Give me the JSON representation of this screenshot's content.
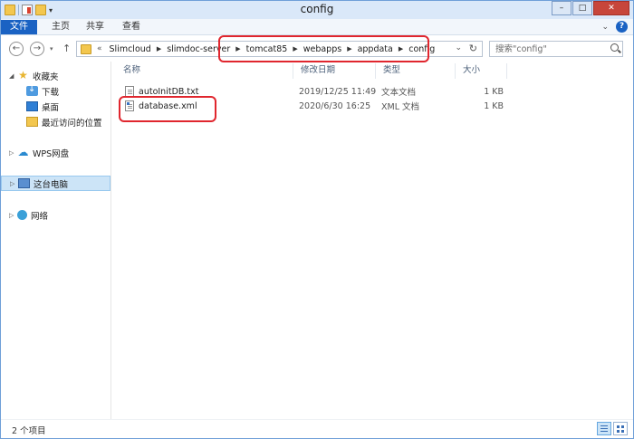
{
  "window": {
    "title": "config"
  },
  "ribbon": {
    "tabs": [
      "文件",
      "主页",
      "共享",
      "查看"
    ]
  },
  "address": {
    "more": "«",
    "crumbs": [
      "Slimcloud",
      "slimdoc-server",
      "tomcat85",
      "webapps",
      "appdata",
      "config"
    ]
  },
  "search": {
    "placeholder": "搜索\"config\""
  },
  "nav": {
    "favorites": "收藏夹",
    "downloads": "下载",
    "desktop": "桌面",
    "recent": "最近访问的位置",
    "wps": "WPS网盘",
    "thispc": "这台电脑",
    "network": "网络"
  },
  "columns": {
    "name": "名称",
    "date": "修改日期",
    "type": "类型",
    "size": "大小"
  },
  "files": [
    {
      "name": "autoInitDB.txt",
      "date": "2019/12/25 11:49",
      "type": "文本文档",
      "size": "1 KB"
    },
    {
      "name": "database.xml",
      "date": "2020/6/30 16:25",
      "type": "XML 文档",
      "size": "1 KB"
    }
  ],
  "status": {
    "count": "2 个项目"
  },
  "colors": {
    "highlight": "#e0262e",
    "file_tab": "#1a62c3",
    "selection": "#cce4f7"
  }
}
